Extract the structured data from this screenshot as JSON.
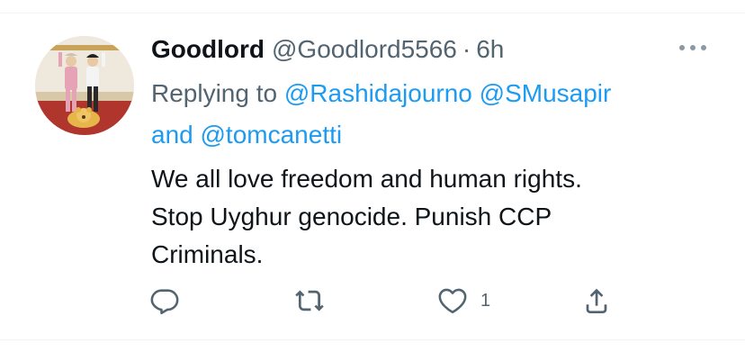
{
  "tweet": {
    "display_name": "Goodlord",
    "handle": "@Goodlord5566",
    "separator": "·",
    "time": "6h",
    "reply_prefix": "Replying to",
    "mentions": [
      "@Rashidajourno",
      "@SMusapir",
      "@tomcanetti"
    ],
    "reply_joiner": "and",
    "text_lines": [
      "We all love freedom and human rights.",
      "Stop Uyghur genocide. Punish CCP",
      "Criminals."
    ]
  },
  "actions": {
    "reply": {
      "icon": "reply-icon",
      "count": ""
    },
    "retweet": {
      "icon": "retweet-icon",
      "count": ""
    },
    "like": {
      "icon": "heart-icon",
      "count": "1"
    },
    "share": {
      "icon": "share-icon",
      "count": ""
    }
  },
  "colors": {
    "text": "#0f1419",
    "secondary": "#536471",
    "link": "#1d9bf0",
    "divider": "#eff3f4"
  }
}
